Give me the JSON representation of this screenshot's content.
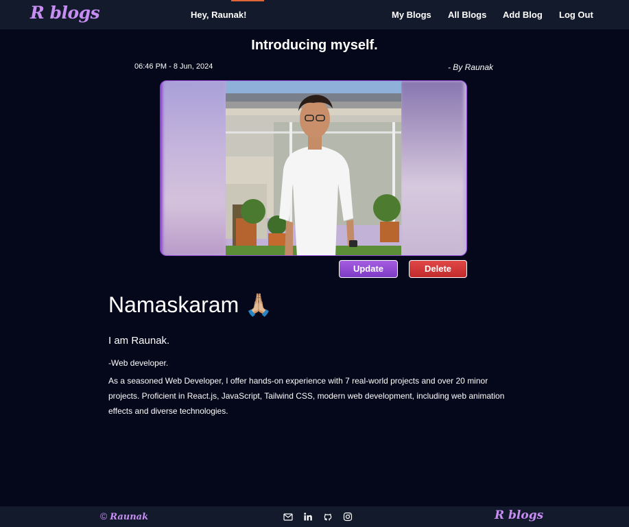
{
  "nav": {
    "logo": "R blogs",
    "greeting": "Hey, Raunak!",
    "links": [
      "My Blogs",
      "All Blogs",
      "Add Blog",
      "Log Out"
    ]
  },
  "post": {
    "title": "Introducing myself.",
    "date": "06:46 PM - 8 Jun, 2024",
    "author": "- By Raunak",
    "update_label": "Update",
    "delete_label": "Delete",
    "heading": "Namaskaram 🙏🏼",
    "intro": "I am Raunak.",
    "role": "-Web developer.",
    "body": "As a seasoned Web Developer, I offer hands-on experience with 7 real-world projects and over 20 minor projects. Proficient in React.js, JavaScript, Tailwind CSS, modern web development, including web animation effects and diverse technologies."
  },
  "footer": {
    "copyright_symbol": "©",
    "copyright_name": "Raunak",
    "icons": [
      "mail-icon",
      "linkedin-icon",
      "github-icon",
      "instagram-icon"
    ],
    "logo": "R blogs"
  },
  "colors": {
    "background": "#05071a",
    "navbar": "#131a2c",
    "accent": "#c68df2",
    "update_button": "#8f4bd6",
    "delete_button": "#d23a3a"
  }
}
